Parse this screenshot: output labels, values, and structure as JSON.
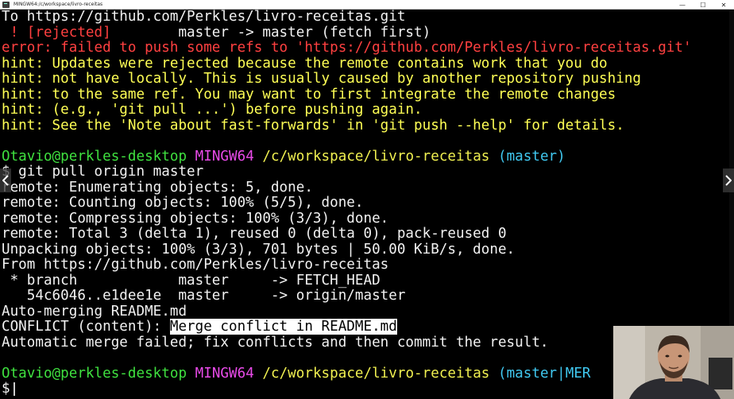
{
  "window": {
    "title": "MINGW64:/c/workspace/livro-receitas",
    "controls": {
      "minimize": "—",
      "maximize": "☐",
      "close": "✕"
    }
  },
  "terminal": {
    "push_output": {
      "to_line": "To https://github.com/Perkles/livro-receitas.git",
      "rejected_flag": " ! [rejected]",
      "rejected_refs": "        master -> master (fetch first)",
      "error_line": "error: failed to push some refs to 'https://github.com/Perkles/livro-receitas.git'",
      "hints": [
        "hint: Updates were rejected because the remote contains work that you do",
        "hint: not have locally. This is usually caused by another repository pushing",
        "hint: to the same ref. You may want to first integrate the remote changes",
        "hint: (e.g., 'git pull ...') before pushing again.",
        "hint: See the 'Note about fast-forwards' in 'git push --help' for details."
      ]
    },
    "prompt1": {
      "user_host": "Otavio@perkles-desktop",
      "shell": "MINGW64",
      "path": "/c/workspace/livro-receitas",
      "branch": "(master)"
    },
    "command": "$ git pull origin master",
    "pull_output": [
      "remote: Enumerating objects: 5, done.",
      "remote: Counting objects: 100% (5/5), done.",
      "remote: Compressing objects: 100% (3/3), done.",
      "remote: Total 3 (delta 1), reused 0 (delta 0), pack-reused 0",
      "Unpacking objects: 100% (3/3), 701 bytes | 50.00 KiB/s, done.",
      "From https://github.com/Perkles/livro-receitas",
      " * branch            master     -> FETCH_HEAD",
      "   54c6046..e1dee1e  master     -> origin/master",
      "Auto-merging README.md"
    ],
    "conflict": {
      "prefix": "CONFLICT (content): ",
      "highlight": "Merge conflict in README.md"
    },
    "merge_failed": "Automatic merge failed; fix conflicts and then commit the result.",
    "prompt2": {
      "user_host": "Otavio@perkles-desktop",
      "shell": "MINGW64",
      "path": "/c/workspace/livro-receitas",
      "branch": "(master|MER"
    },
    "final_prompt": "$"
  },
  "navigation": {
    "prev_icon": "chevron-left-icon",
    "next_icon": "chevron-right-icon"
  },
  "colors": {
    "background": "#000000",
    "text": "#f2f2f2",
    "error": "#ff4040",
    "hint": "#ffff55",
    "user_host": "#3fe03f",
    "shell": "#e94be9",
    "path": "#f0f050",
    "branch": "#40c8f0"
  }
}
